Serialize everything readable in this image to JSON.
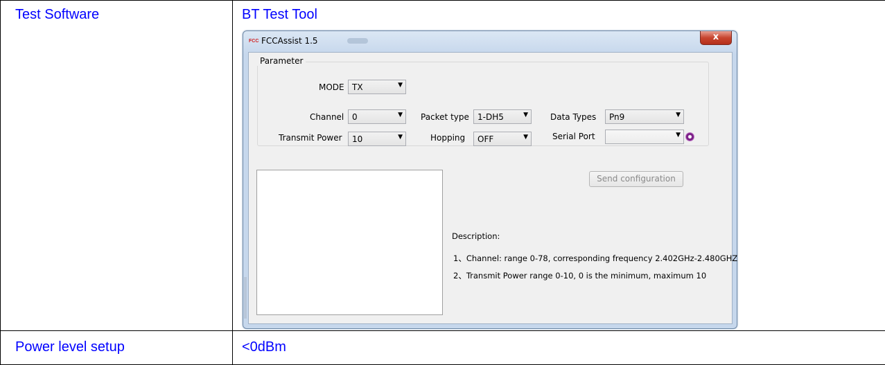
{
  "table": {
    "rows": [
      {
        "label": "Test Software",
        "value": "BT Test Tool"
      },
      {
        "label": "Power level setup",
        "value": "<0dBm"
      }
    ]
  },
  "window": {
    "title": "FCCAssist 1.5",
    "app_icon_text": "FCC",
    "close_label": "x",
    "group_label": "Parameter",
    "fields": {
      "mode": {
        "label": "MODE",
        "value": "TX"
      },
      "channel": {
        "label": "Channel",
        "value": "0"
      },
      "packet_type": {
        "label": "Packet type",
        "value": "1-DH5"
      },
      "data_types": {
        "label": "Data Types",
        "value": "Pn9"
      },
      "transmit_power": {
        "label": "Transmit Power",
        "value": "10"
      },
      "hopping": {
        "label": "Hopping",
        "value": "OFF"
      },
      "serial_port": {
        "label": "Serial Port",
        "value": ""
      }
    },
    "send_button_label": "Send configuration",
    "description": {
      "heading": "Description:",
      "lines": [
        "1、Channel: range 0-78, corresponding frequency 2.402GHz-2.480GHZ",
        "2、Transmit Power  range 0-10, 0 is the minimum, maximum 10"
      ]
    }
  },
  "colors": {
    "label_text": "#0000ff",
    "window_frame": "#c6d7ec",
    "close_button": "#c8452f"
  }
}
